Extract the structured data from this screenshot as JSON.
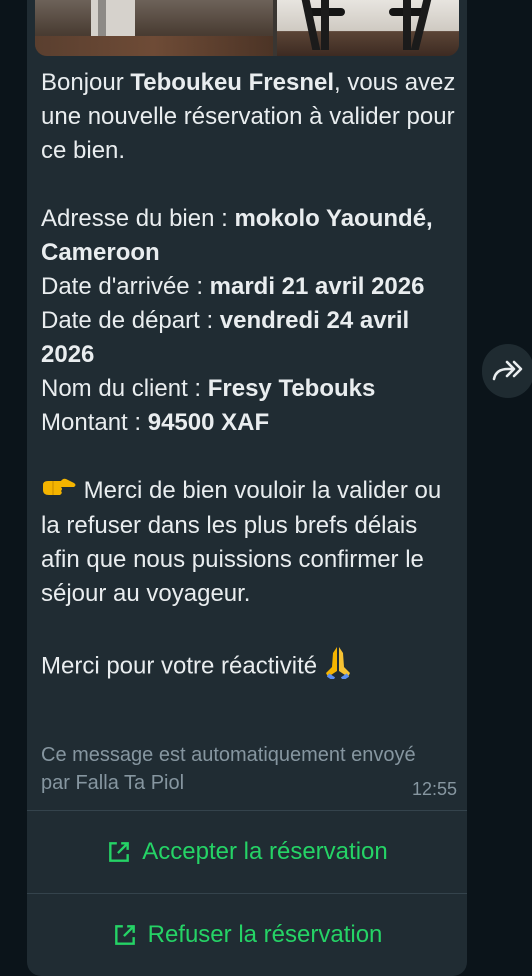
{
  "message": {
    "greeting_prefix": "Bonjour ",
    "host_name": "Teboukeu Fresnel",
    "greeting_suffix": ", vous avez une nouvelle réservation à valider pour ce bien.",
    "address_label": "Adresse du bien : ",
    "address_value": "mokolo Yaoundé, Cameroon",
    "arrival_label": "Date d'arrivée : ",
    "arrival_value": "mardi 21 avril 2026",
    "departure_label": "Date de départ : ",
    "departure_value": "vendredi 24 avril 2026",
    "client_label": "Nom du client : ",
    "client_value": "Fresy Tebouks",
    "amount_label": "Montant : ",
    "amount_value": "94500 XAF",
    "request_text": " Merci de bien vouloir la valider ou la refuser dans les plus brefs délais afin que nous puissions confirmer le séjour au voyageur.",
    "thanks_text": "Merci pour votre réactivité ",
    "auto_note": "Ce message est automatiquement envoyé par Falla Ta Piol",
    "time": "12:55",
    "pointing_icon": "backhand-pointing-right-emoji",
    "pray_icon": "folded-hands-emoji"
  },
  "actions": {
    "accept_label": "Accepter la réservation",
    "refuse_label": "Refuser la réservation",
    "icon": "external-link-icon"
  },
  "forward_icon": "forward-arrow-icon",
  "colors": {
    "background": "#0b141a",
    "bubble": "#202c33",
    "text": "#e9edef",
    "secondary_text": "#8696a0",
    "accent": "#25d366"
  }
}
